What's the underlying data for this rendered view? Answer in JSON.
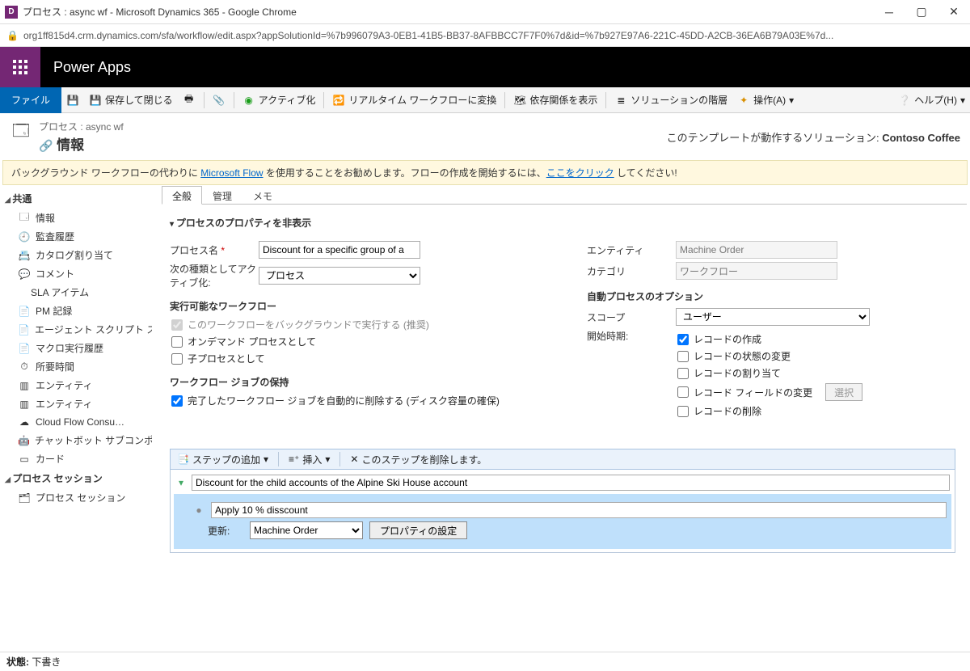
{
  "window": {
    "title": "プロセス : async wf - Microsoft Dynamics 365 - Google Chrome",
    "url": "org1ff815d4.crm.dynamics.com/sfa/workflow/edit.aspx?appSolutionId=%7b996079A3-0EB1-41B5-BB37-8AFBBCC7F7F0%7d&id=%7b927E97A6-221C-45DD-A2CB-36EA6B79A03E%7d..."
  },
  "appbar": {
    "name": "Power Apps"
  },
  "cmdbar": {
    "file": "ファイル",
    "save_close": "保存して閉じる",
    "activate": "アクティブ化",
    "convert_realtime": "リアルタイム ワークフローに変換",
    "show_deps": "依存関係を表示",
    "solution_layers": "ソリューションの階層",
    "actions": "操作(A)",
    "help": "ヘルプ(H)"
  },
  "header": {
    "crumb": "プロセス : async wf",
    "title": "情報",
    "solution_label": "このテンプレートが動作するソリューション: ",
    "solution_name": "Contoso Coffee"
  },
  "banner": {
    "pre": "バックグラウンド ワークフローの代わりに ",
    "link1": "Microsoft Flow",
    "mid": " を使用することをお勧めします。フローの作成を開始するには、",
    "link2": "ここをクリック",
    "post": " してください!"
  },
  "leftnav": {
    "hdr_common": "共通",
    "items": [
      "情報",
      "監査履歴",
      "カタログ割り当て",
      "コメント",
      "SLA アイテム",
      "PM 記録",
      "エージェント スクリプト ス…",
      "マクロ実行履歴",
      "所要時間",
      "エンティティ",
      "エンティティ",
      "Cloud Flow Consu…",
      "チャットボット サブコンポ…",
      "カード"
    ],
    "hdr_sessions": "プロセス セッション",
    "session_item": "プロセス セッション"
  },
  "tabs": {
    "general": "全般",
    "admin": "管理",
    "notes": "メモ"
  },
  "props": {
    "toggle": "プロセスのプロパティを非表示",
    "name_label": "プロセス名",
    "name_value": "Discount for a specific group of a",
    "activate_as_label": "次の種類としてアクティブ化:",
    "activate_as_value": "プロセス",
    "entity_label": "エンティティ",
    "entity_value": "Machine Order",
    "category_label": "カテゴリ",
    "category_value": "ワークフロー",
    "runnable_hdr": "実行可能なワークフロー",
    "chk_bg": "このワークフローをバックグラウンドで実行する (推奨)",
    "chk_ondemand": "オンデマンド プロセスとして",
    "chk_child": "子プロセスとして",
    "retain_hdr": "ワークフロー ジョブの保持",
    "chk_retain": "完了したワークフロー ジョブを自動的に削除する (ディスク容量の確保)",
    "auto_hdr": "自動プロセスのオプション",
    "scope_label": "スコープ",
    "scope_value": "ユーザー",
    "start_label": "開始時期:",
    "chk_create": "レコードの作成",
    "chk_status": "レコードの状態の変更",
    "chk_assign": "レコードの割り当て",
    "chk_field": "レコード フィールドの変更",
    "btn_select": "選択",
    "chk_delete": "レコードの削除"
  },
  "steptb": {
    "add": "ステップの追加",
    "insert": "挿入",
    "delete": "このステップを削除します。"
  },
  "steps": {
    "stage_name": "Discount for the child accounts of the Alpine Ski House account",
    "step_desc": "Apply 10 % disscount",
    "update_label": "更新:",
    "update_entity": "Machine Order",
    "set_props": "プロパティの設定"
  },
  "status": {
    "label": "状態: ",
    "value": "下書き"
  }
}
